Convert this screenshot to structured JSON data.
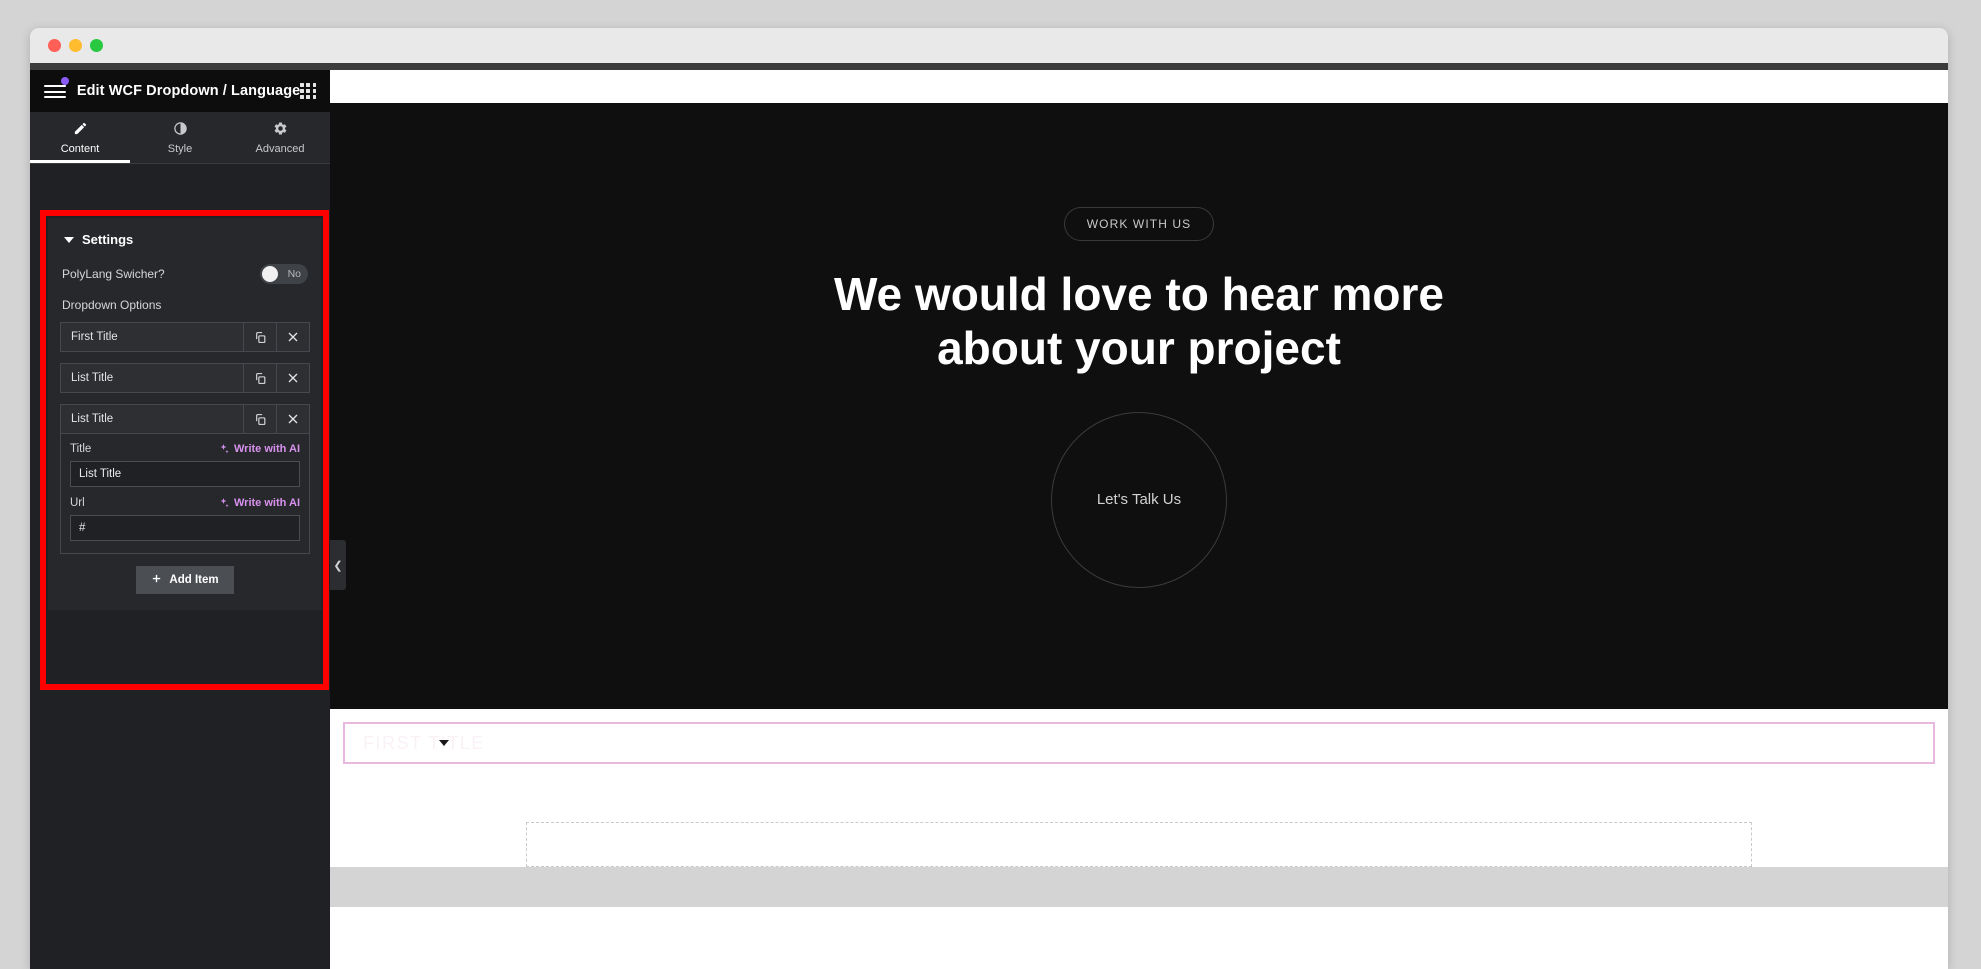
{
  "window": {
    "traffic_lights": [
      "close",
      "minimize",
      "maximize"
    ]
  },
  "panel": {
    "title": "Edit WCF Dropdown / Language",
    "hamburger_icon": "hamburger-menu-icon",
    "apps_icon": "apps-grid-icon",
    "notification_dot_color": "#8b5cf6",
    "tabs": [
      {
        "label": "Content",
        "icon": "pencil-icon",
        "active": true
      },
      {
        "label": "Style",
        "icon": "contrast-circle-icon",
        "active": false
      },
      {
        "label": "Advanced",
        "icon": "gear-icon",
        "active": false
      }
    ],
    "collapse_handle_icon": "chevron-left-icon"
  },
  "settings": {
    "title": "Settings",
    "collapse_caret": "caret-down-icon",
    "polylang": {
      "label": "PolyLang Swicher?",
      "toggle_value": "No",
      "toggle_on": false
    },
    "dropdown_options_label": "Dropdown Options",
    "items": [
      {
        "title": "First Title",
        "duplicate_icon": "copy-icon",
        "remove_icon": "close-x-icon"
      },
      {
        "title": "List Title",
        "duplicate_icon": "copy-icon",
        "remove_icon": "close-x-icon"
      },
      {
        "title": "List Title",
        "duplicate_icon": "copy-icon",
        "remove_icon": "close-x-icon"
      }
    ],
    "expanded_item": {
      "title_label": "Title",
      "title_value": "List Title",
      "url_label": "Url",
      "url_value": "#",
      "ai_label": "Write with AI",
      "ai_icon": "sparkle-icon",
      "ai_color": "#d892ee"
    },
    "add_item_label": "Add Item",
    "add_item_icon": "plus-icon",
    "highlight_color": "#ff0000"
  },
  "canvas": {
    "hero": {
      "pill_label": "WORK WITH US",
      "heading_line1": "We would love to hear more",
      "heading_line2": "about your project",
      "circle_label": "Let's Talk Us",
      "background": "#0f0f0f"
    },
    "dropdown_widget": {
      "label": "FIRST TITLE",
      "caret_icon": "chevron-down-icon",
      "border_color": "#e8b8e0"
    },
    "placeholder_box": "dashed-drop-area"
  }
}
